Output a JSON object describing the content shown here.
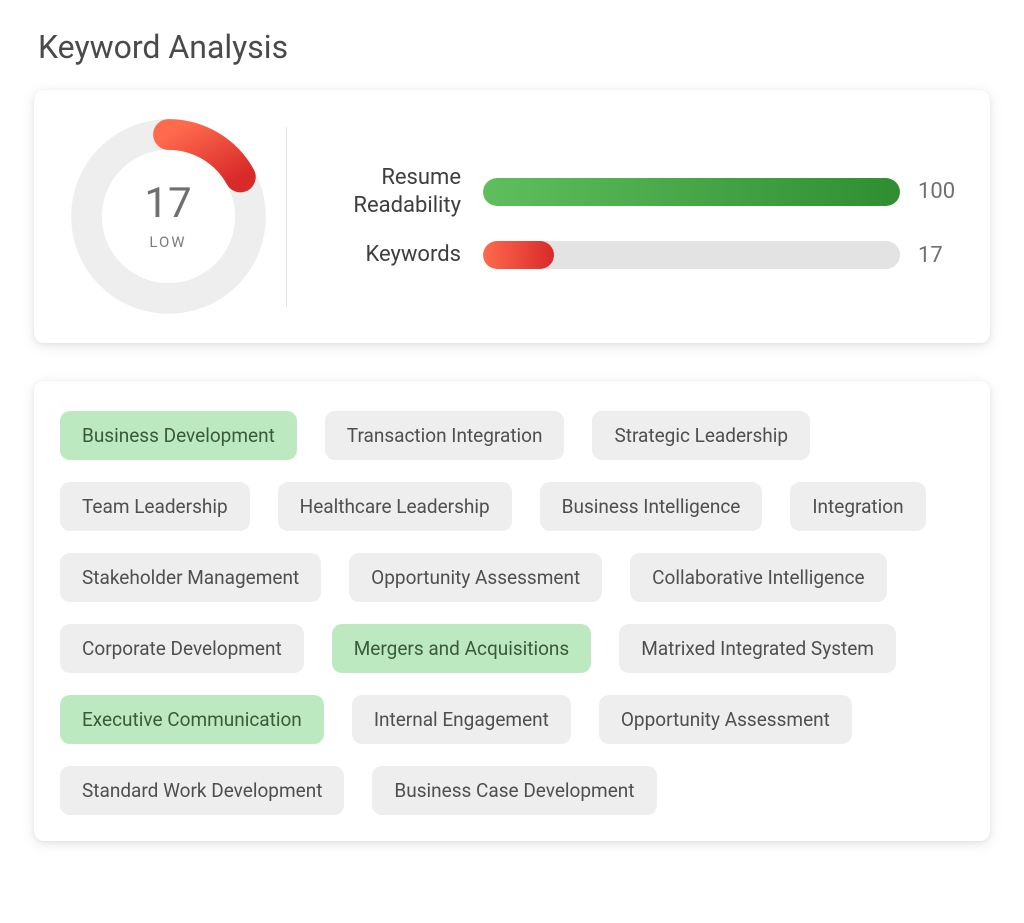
{
  "title": "Keyword Analysis",
  "gauge": {
    "value": "17",
    "label": "LOW",
    "fill_percent": 17,
    "arc_color_start": "#ff6a4d",
    "arc_color_end": "#d82a2a",
    "track_color": "#eeeeee"
  },
  "bars": [
    {
      "label": "Resume Readability",
      "value": 100,
      "display": "100",
      "color_start": "#5fbf5f",
      "color_end": "#2f8e2f"
    },
    {
      "label": "Keywords",
      "value": 17,
      "display": "17",
      "color_start": "#ff6a4d",
      "color_end": "#d82a2a"
    }
  ],
  "keywords": [
    {
      "text": "Business Development",
      "matched": true
    },
    {
      "text": "Transaction Integration",
      "matched": false
    },
    {
      "text": "Strategic Leadership",
      "matched": false
    },
    {
      "text": "Team Leadership",
      "matched": false
    },
    {
      "text": "Healthcare Leadership",
      "matched": false
    },
    {
      "text": "Business Intelligence",
      "matched": false
    },
    {
      "text": "Integration",
      "matched": false
    },
    {
      "text": "Stakeholder Management",
      "matched": false
    },
    {
      "text": "Opportunity Assessment",
      "matched": false
    },
    {
      "text": "Collaborative Intelligence",
      "matched": false
    },
    {
      "text": "Corporate Development",
      "matched": false
    },
    {
      "text": "Mergers and Acquisitions",
      "matched": true
    },
    {
      "text": "Matrixed Integrated System",
      "matched": false
    },
    {
      "text": "Executive Communication",
      "matched": true
    },
    {
      "text": "Internal Engagement",
      "matched": false
    },
    {
      "text": "Opportunity Assessment",
      "matched": false
    },
    {
      "text": "Standard Work Development",
      "matched": false
    },
    {
      "text": "Business Case Development",
      "matched": false
    }
  ]
}
